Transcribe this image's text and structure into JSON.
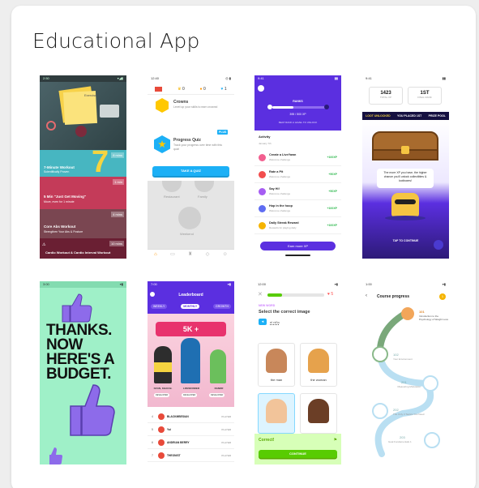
{
  "page": {
    "title": "Educational App"
  },
  "colors": {
    "card": "#ffffff",
    "duo_green": "#58cc02",
    "duo_blue": "#1cb0f6",
    "duo_purple": "#5b2fe0",
    "budget_bg": "#9ff0c8",
    "budget_purple": "#8d6bea"
  },
  "screens": [
    {
      "name": "workout-app",
      "status_time": "2:50",
      "top_label": "Exercise",
      "items": [
        {
          "title": "7-Minute Workout",
          "subtitle": "Scientifically Proven",
          "badge": "8 mins",
          "number": "7",
          "color": "#47b6c1"
        },
        {
          "title": "5 Min \"Just Get Moving\"",
          "subtitle": "Move, even for 1 minute",
          "badge": "1 min",
          "color": "#c43b59"
        },
        {
          "title": "Core Abs Workout",
          "subtitle": "Strengthen Your Abs & Posture",
          "badge": "4 mins",
          "color": "#7a4651"
        },
        {
          "title": "Cardio Workout & Cardio Interval Workout",
          "subtitle": "",
          "badge": "10 mins",
          "color": "#6a1f33"
        }
      ]
    },
    {
      "name": "duolingo-profile",
      "status_time": "12:40",
      "stats": [
        "0",
        "0",
        "1"
      ],
      "crowns_title": "Crowns",
      "crowns_desc": "Level up your skills to earn crowns!",
      "quiz_badge": "PLUS",
      "quiz_title": "Progress Quiz",
      "quiz_desc": "Track your progress over time with this quiz!",
      "quiz_button": "TAKE A QUIZ",
      "skills": [
        "Restaurant",
        "Family",
        "Weekend"
      ]
    },
    {
      "name": "xp-activity",
      "status_time": "9:41",
      "header_label": "RANKS",
      "xp_label": "395 / 500 XP",
      "subtitle": "BEAT RANK A LEVEL TO UNLOCK",
      "section_title": "Activity",
      "section_sub": "January 7th",
      "activities": [
        {
          "title": "Create a LiveYawn",
          "sub": "Welcome challenge",
          "xp": "+100XP",
          "color": "#f25f8f"
        },
        {
          "title": "Rate a Pit",
          "sub": "Welcome challenge",
          "xp": "+50XP",
          "color": "#f24e4e"
        },
        {
          "title": "Say Hi!",
          "sub": "Welcome challenge",
          "xp": "+50XP",
          "color": "#a65df2"
        },
        {
          "title": "Hop in the hoop",
          "sub": "Welcome challenge",
          "xp": "+100XP",
          "color": "#5f6df2"
        },
        {
          "title": "Daily Streak Reward",
          "sub": "Rewards for playing daily",
          "xp": "+100XP",
          "color": "#f5b400"
        }
      ],
      "button": "Earn more XP"
    },
    {
      "name": "treasure-chest",
      "status_time": "9:41",
      "stat1_value": "1423",
      "stat1_label": "TOTAL XP",
      "stat2_value": "1ST",
      "stat2_label": "FINAL RANK",
      "banner_items": [
        "LOOT UNLOCKED",
        "YOU PLACED 1ST",
        "PRIZE POOL"
      ],
      "message": "The more XP you have, the higher chance you'll unlock collectibles & lootboxes!",
      "cta": "TAP TO CONTINUE"
    },
    {
      "name": "budget-app",
      "status_time": "3:00",
      "text_lines": [
        "THANKS.",
        "NOW",
        "HERE'S A",
        "BUDGET."
      ]
    },
    {
      "name": "leaderboard",
      "status_time": "7:00",
      "title": "Leaderboard",
      "tabs": [
        "WEEKLY",
        "MONTHLY",
        "GROWTH"
      ],
      "banner": "5K +",
      "podium": [
        {
          "name": "OZAN, KHAN B.",
          "tag": "DEVELOPER"
        },
        {
          "name": "LIFEWONDER",
          "tag": "DEVELOPER"
        },
        {
          "name": "RANDR",
          "tag": "DEVELOPER"
        }
      ],
      "rows": [
        {
          "rank": "4",
          "name": "BLACKMBESIAN",
          "score": "PLAYER"
        },
        {
          "rank": "5",
          "name": "Yui",
          "score": "PLAYER"
        },
        {
          "rank": "6",
          "name": "ANDRIAN BERRY",
          "score": "PLAYER"
        },
        {
          "rank": "7",
          "name": "THEONIST",
          "score": "PLAYER"
        }
      ]
    },
    {
      "name": "duolingo-quiz",
      "status_time": "12:00",
      "hearts": "5",
      "tag": "NEW WORD",
      "question": "Select the correct image",
      "word": "el niño",
      "options": [
        "the man",
        "the woman",
        "the boy",
        "the girl"
      ],
      "result": "Correct!",
      "continue": "CONTINUE"
    },
    {
      "name": "course-progress",
      "status_time": "1:00",
      "title": "Course progress",
      "badge": "1",
      "nodes": [
        {
          "num": "101",
          "label": "Introduction to the Psychology of Weight Loss"
        },
        {
          "num": "102",
          "label": "Your Environment"
        },
        {
          "num": "201",
          "label": "Measuring Motivation"
        },
        {
          "num": "202",
          "label": "The Only 3 Tactics You Need"
        },
        {
          "num": "203",
          "label": "Goal Fundamentals 1"
        }
      ]
    }
  ]
}
